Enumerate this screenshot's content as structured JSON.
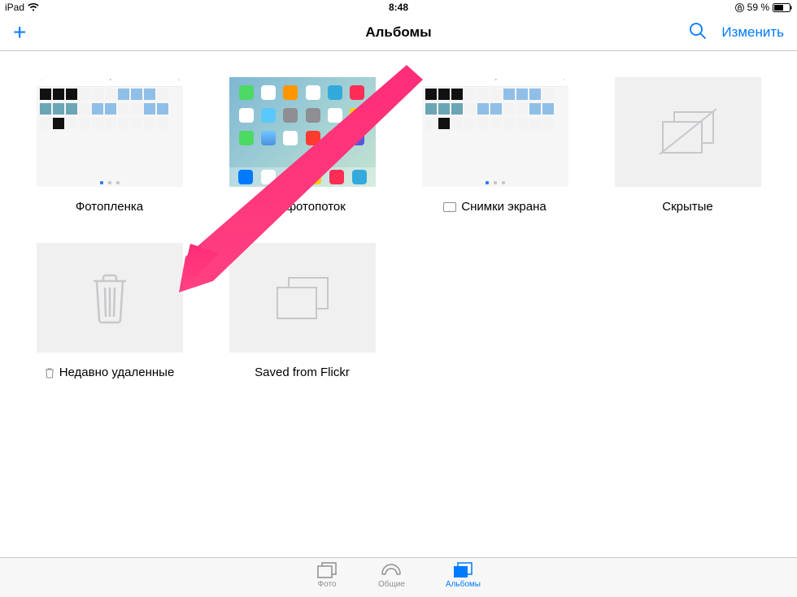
{
  "status": {
    "device": "iPad",
    "time": "8:48",
    "battery_text": "59 %"
  },
  "nav": {
    "title": "Альбомы",
    "edit_label": "Изменить"
  },
  "albums": [
    {
      "label": "Фотопленка",
      "icon": null,
      "thumb_type": "screenshot"
    },
    {
      "label": "Мой фотопоток",
      "icon": null,
      "thumb_type": "homescreen"
    },
    {
      "label": "Снимки экрана",
      "icon": "ipad",
      "thumb_type": "screenshot"
    },
    {
      "label": "Скрытые",
      "icon": null,
      "thumb_type": "hidden"
    },
    {
      "label": "Недавно удаленные",
      "icon": "trash",
      "thumb_type": "trash"
    },
    {
      "label": "Saved from Flickr",
      "icon": null,
      "thumb_type": "stack"
    }
  ],
  "tabs": [
    {
      "label": "Фото",
      "active": false
    },
    {
      "label": "Общие",
      "active": false
    },
    {
      "label": "Альбомы",
      "active": true
    }
  ],
  "colors": {
    "tint": "#007aff",
    "arrow": "#ff2d78"
  }
}
